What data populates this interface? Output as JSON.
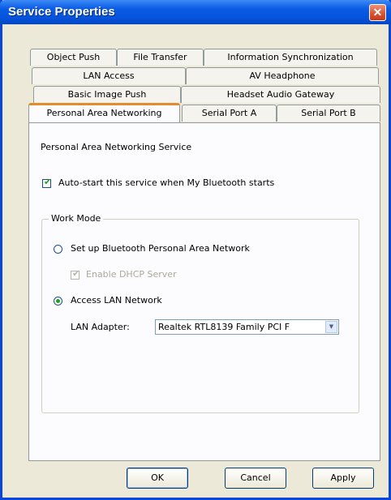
{
  "window": {
    "title": "Service Properties"
  },
  "tabs": {
    "row1": [
      "Object Push",
      "File Transfer",
      "Information Synchronization"
    ],
    "row2": [
      "LAN Access",
      "AV Headphone"
    ],
    "row3": [
      "Basic Image Push",
      "Headset Audio Gateway"
    ],
    "row4": [
      "Personal Area Networking",
      "Serial Port A",
      "Serial Port B"
    ],
    "active": "Personal Area Networking"
  },
  "panel": {
    "section_title": "Personal Area Networking Service",
    "autostart": {
      "label": "Auto-start this service when My Bluetooth starts",
      "checked": true
    },
    "work_mode": {
      "legend": "Work Mode",
      "option_pan": {
        "label": "Set up Bluetooth Personal Area Network",
        "selected": false
      },
      "dhcp": {
        "label": "Enable DHCP Server",
        "checked": true,
        "enabled": false
      },
      "option_lan": {
        "label": "Access LAN Network",
        "selected": true
      },
      "adapter_label": "LAN Adapter:",
      "adapter_value": "Realtek RTL8139 Family PCI F"
    }
  },
  "buttons": {
    "ok": "OK",
    "cancel": "Cancel",
    "apply": "Apply"
  },
  "icons": {
    "close": "close-icon",
    "dropdown": "chevron-down-icon",
    "check": "checkmark-icon"
  },
  "colors": {
    "title_bar": "#0b5ce6",
    "active_tab_accent": "#e68b2c",
    "check_green": "#21a121"
  }
}
